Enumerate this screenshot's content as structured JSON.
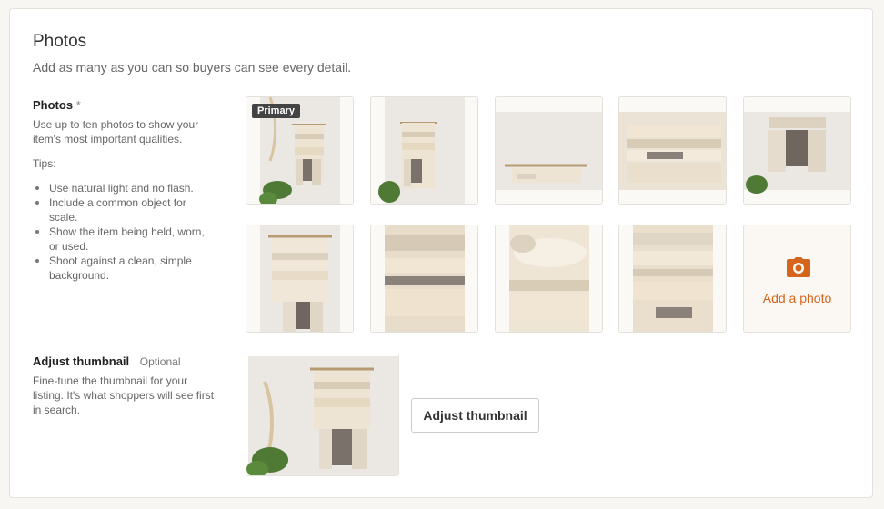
{
  "section": {
    "title": "Photos",
    "subtitle": "Add as many as you can so buyers can see every detail."
  },
  "photos": {
    "label": "Photos",
    "required_mark": "*",
    "help": "Use up to ten photos to show your item's most important qualities.",
    "tips_heading": "Tips:",
    "tips": [
      "Use natural light and no flash.",
      "Include a common object for scale.",
      "Show the item being held, worn, or used.",
      "Shoot against a clean, simple background."
    ],
    "primary_badge": "Primary",
    "add_photo_label": "Add a photo",
    "add_photo_icon": "camera-icon",
    "accent_color": "#d5641c"
  },
  "thumbnail": {
    "label": "Adjust thumbnail",
    "optional": "Optional",
    "help": "Fine-tune the thumbnail for your listing. It's what shoppers will see first in search.",
    "button_label": "Adjust thumbnail"
  }
}
